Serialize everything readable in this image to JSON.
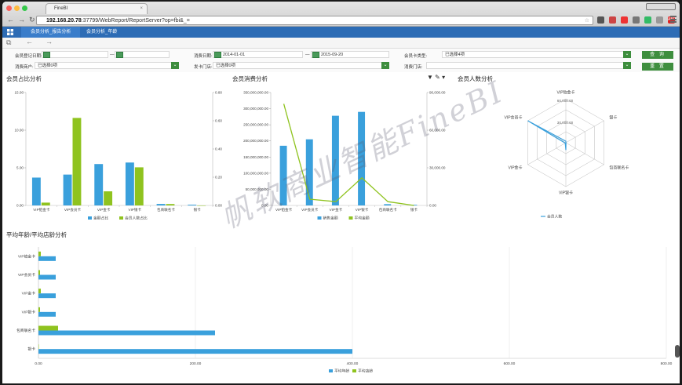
{
  "browser": {
    "tab_title": "FineBI",
    "url_host": "192.168.20.78",
    "url_rest": ":37799/WebReport/ReportServer?op=fbi&_=",
    "ext_badge": "ABP"
  },
  "app": {
    "tabs": [
      {
        "label": "会员分析_报告分析",
        "active": true
      },
      {
        "label": "会员分析_年龄",
        "active": false
      }
    ]
  },
  "filters": {
    "reg_date_label": "会员登记日期:",
    "reg_date_sep": "—",
    "consume_date_label": "消费日期:",
    "consume_date_from": "2014-01-01",
    "consume_date_sep": "—",
    "consume_date_to": "2015-09-20",
    "card_type_label": "会员卡类型:",
    "card_type_value": "已选择4项",
    "merchant_label": "消费商户:",
    "merchant_value": "已选择0项",
    "issue_store_label": "发卡门店:",
    "issue_store_value": "已选择0项",
    "consume_store_label": "消费门店:",
    "consume_store_value": "",
    "query_btn": "查 询",
    "reset_btn": "重 置"
  },
  "titles": {
    "share": "会员占比分析",
    "consume": "会员消费分析",
    "count": "会员人数分析",
    "age": "平均年龄/平均店龄分析"
  },
  "watermark": "帆软商业智能FineBI",
  "chart_data": [
    {
      "type": "bar",
      "categories": [
        "VIP铂金卡",
        "VIP会员卡",
        "VIP金卡",
        "VIP银卡",
        "包商联名卡",
        "银卡"
      ],
      "series": [
        {
          "name": "金额占比",
          "axis": "left",
          "values": [
            3.7,
            4.1,
            5.5,
            5.7,
            0.2,
            0.1
          ],
          "color": "#3aa0dc"
        },
        {
          "name": "会员人数占比",
          "axis": "right",
          "values": [
            0.02,
            0.62,
            0.1,
            0.27,
            0.01,
            0.0
          ],
          "color": "#8fc31f"
        }
      ],
      "ylim": [
        0,
        15
      ],
      "y2lim": [
        0,
        0.8
      ],
      "yticks": [
        "0.00",
        "5.00",
        "10.00",
        "15.00"
      ],
      "y2ticks": [
        "0.00",
        "0.20",
        "0.40",
        "0.60",
        "0.80"
      ]
    },
    {
      "type": "bar",
      "categories": [
        "VIP铂金卡",
        "VIP会员卡",
        "VIP金卡",
        "VIP银卡",
        "包商联名卡",
        "银卡"
      ],
      "series": [
        {
          "name": "销售金额",
          "axis": "left",
          "values": [
            185000000,
            205000000,
            278000000,
            290000000,
            4000000,
            2000000
          ],
          "color": "#3aa0dc"
        },
        {
          "name": "平均金额",
          "axis": "right",
          "type": "line",
          "values": [
            81000,
            5000,
            3000,
            22000,
            3000,
            0
          ],
          "color": "#8fc31f"
        }
      ],
      "ylim": [
        0,
        350000000
      ],
      "y2lim": [
        0,
        90000
      ],
      "yticks": [
        "0.00",
        "50,000,000.00",
        "100,000,000.00",
        "150,000,000.00",
        "200,000,000.00",
        "250,000,000.00",
        "300,000,000.00",
        "350,000,000.00"
      ],
      "y2ticks": [
        "0.00",
        "30,000.00",
        "60,000.00",
        "90,000.00"
      ]
    },
    {
      "type": "radar",
      "categories": [
        "VIP铂金卡",
        "银卡",
        "包商联名卡",
        "VIP银卡",
        "VIP金卡",
        "VIP会员卡"
      ],
      "series": [
        {
          "name": "会员人数",
          "values": [
            2000,
            100,
            200,
            10000,
            1000,
            60000
          ],
          "color": "#3aa0dc"
        }
      ],
      "ylim": [
        0,
        60000
      ],
      "rticks": [
        "30,000.00",
        "60,000.00"
      ]
    },
    {
      "type": "bar",
      "orientation": "horizontal",
      "categories": [
        "VIP铂金卡",
        "VIP会员卡",
        "VIP金卡",
        "VIP银卡",
        "包商联名卡",
        "银卡"
      ],
      "series": [
        {
          "name": "平均年龄",
          "values": [
            22,
            22,
            22,
            22,
            225,
            400
          ],
          "color": "#3aa0dc"
        },
        {
          "name": "平均店龄",
          "values": [
            3,
            2,
            3,
            2,
            25,
            0
          ],
          "color": "#8fc31f"
        }
      ],
      "xlim": [
        0,
        400
      ],
      "xticks": [
        "0.00",
        "200.00",
        "400.00",
        "600.00",
        "800.00"
      ]
    }
  ]
}
